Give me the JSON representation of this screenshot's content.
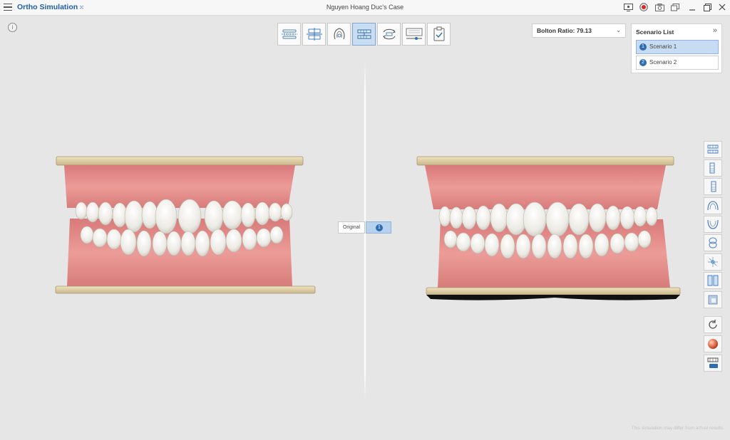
{
  "app": {
    "title": "Ortho Simulation",
    "title_suffix": "⁙",
    "case_title": "Nguyen Hoang Duc's Case",
    "window_icons": [
      "screen-capture-icon",
      "record-icon",
      "camera-icon",
      "multi-window-icon",
      "minimize-icon",
      "maximize-icon",
      "close-icon"
    ]
  },
  "info": {
    "label": "i"
  },
  "toolbar": {
    "tools": [
      {
        "icon": "arch-alignment-icon",
        "active": false
      },
      {
        "icon": "occlusion-plane-icon",
        "active": false
      },
      {
        "icon": "tooth-segmentation-icon",
        "active": false
      },
      {
        "icon": "tooth-movement-icon",
        "active": true
      },
      {
        "icon": "rotate-movement-icon",
        "active": false
      },
      {
        "icon": "staging-icon",
        "active": false
      },
      {
        "icon": "complete-checklist-icon",
        "active": false
      }
    ]
  },
  "bolton": {
    "label": "Bolton Ratio: 79.13"
  },
  "scenario_list": {
    "title": "Scenario List",
    "collapse": "»",
    "items": [
      {
        "num": "1",
        "label": "Scenario 1",
        "selected": true
      },
      {
        "num": "2",
        "label": "Scenario 2",
        "selected": false
      }
    ]
  },
  "compare": {
    "original": "Original",
    "scenario_num": "1"
  },
  "right_tools": [
    "upper-lower-view-icon",
    "left-view-icon",
    "right-view-icon",
    "upper-occlusal-view-icon",
    "lower-occlusal-view-icon",
    "front-view-icon",
    "axis-view-icon",
    "split-view-icon",
    "transparency-icon",
    "reset-view-icon",
    "color-sphere-icon",
    "attachment-icon"
  ],
  "disclaimer": "This simulation may differ from actual results."
}
